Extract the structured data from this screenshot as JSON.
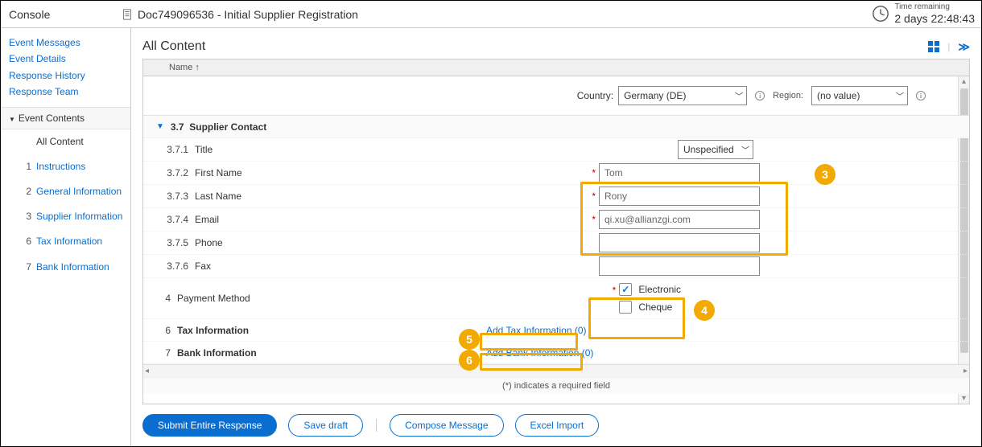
{
  "header": {
    "console": "Console",
    "doc": "Doc749096536 - Initial Supplier Registration",
    "time_label": "Time remaining",
    "time_value": "2 days 22:48:43"
  },
  "sidebar": {
    "group1": {
      "items": [
        {
          "label": "Event Messages"
        },
        {
          "label": "Event Details"
        },
        {
          "label": "Response History"
        },
        {
          "label": "Response Team"
        }
      ]
    },
    "group2": {
      "title": "Event Contents",
      "items": [
        {
          "num": "",
          "label": "All Content"
        },
        {
          "num": "1",
          "label": "Instructions"
        },
        {
          "num": "2",
          "label": "General Information"
        },
        {
          "num": "3",
          "label": "Supplier Information"
        },
        {
          "num": "6",
          "label": "Tax Information"
        },
        {
          "num": "7",
          "label": "Bank Information"
        }
      ]
    }
  },
  "content": {
    "title": "All Content",
    "col_name": "Name ↑",
    "country_label": "Country:",
    "country_value": "Germany (DE)",
    "region_label": "Region:",
    "region_value": "(no value)",
    "section": {
      "num": "3.7",
      "label": "Supplier Contact"
    },
    "fields": {
      "title": {
        "num": "3.7.1",
        "label": "Title",
        "value": "Unspecified"
      },
      "first": {
        "num": "3.7.2",
        "label": "First Name",
        "value": "Tom"
      },
      "last": {
        "num": "3.7.3",
        "label": "Last Name",
        "value": "Rony"
      },
      "email": {
        "num": "3.7.4",
        "label": "Email",
        "value": "qi.xu@allianzgi.com"
      },
      "phone": {
        "num": "3.7.5",
        "label": "Phone",
        "value": ""
      },
      "fax": {
        "num": "3.7.6",
        "label": "Fax",
        "value": ""
      }
    },
    "payment": {
      "num": "4",
      "label": "Payment Method",
      "electronic": "Electronic",
      "cheque": "Cheque"
    },
    "tax": {
      "num": "6",
      "label": "Tax Information",
      "link": "Add Tax Information (0)"
    },
    "bank": {
      "num": "7",
      "label": "Bank Information",
      "link": "Add Bank Information (0)"
    },
    "required_note": "(*) indicates a required field"
  },
  "actions": {
    "submit": "Submit Entire Response",
    "save": "Save draft",
    "compose": "Compose Message",
    "excel": "Excel Import"
  },
  "callouts": {
    "c3": "3",
    "c4": "4",
    "c5": "5",
    "c6": "6"
  }
}
